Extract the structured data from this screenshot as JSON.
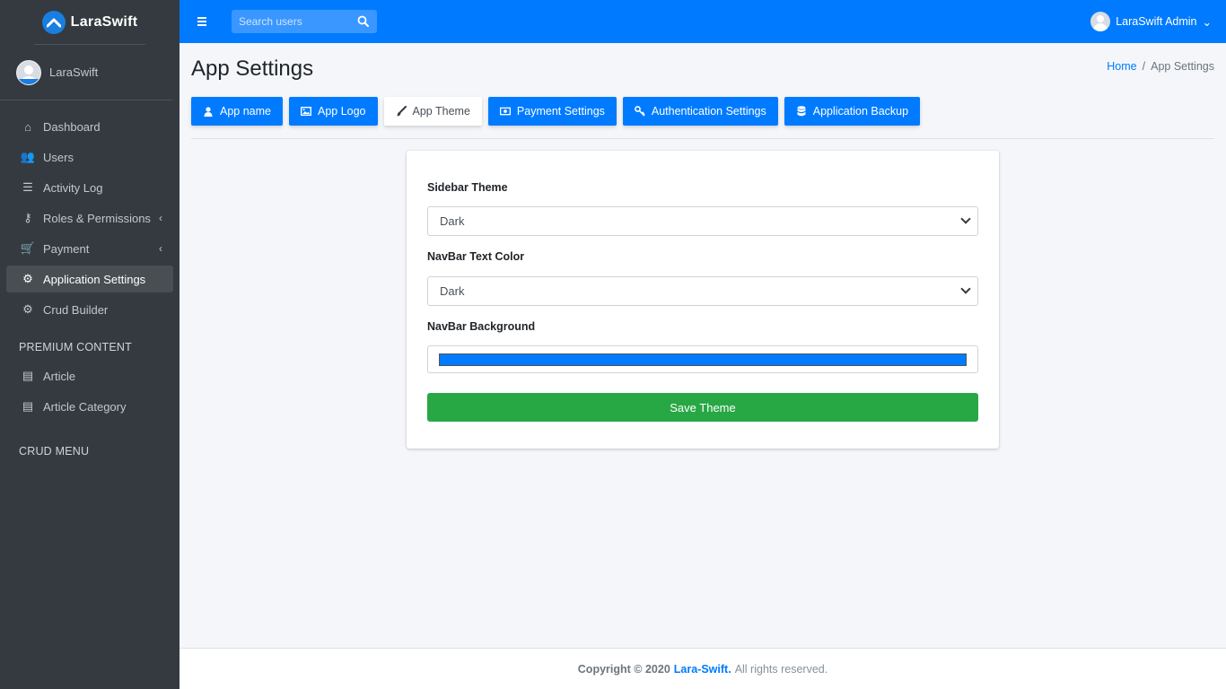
{
  "brand": {
    "name": "LaraSwift",
    "logo_icon": "swift-logo-icon",
    "accent": "#1a7de0"
  },
  "sidebar": {
    "user_name": "LaraSwift",
    "items": [
      {
        "label": "Dashboard",
        "icon": "home-icon",
        "glyph": "⌂"
      },
      {
        "label": "Users",
        "icon": "users-icon",
        "glyph": "👥"
      },
      {
        "label": "Activity Log",
        "icon": "list-icon",
        "glyph": "☰"
      },
      {
        "label": "Roles & Permissions",
        "icon": "key-icon",
        "glyph": "⚷",
        "arrow": "‹"
      },
      {
        "label": "Payment",
        "icon": "cart-icon",
        "glyph": "🛒",
        "arrow": "‹"
      },
      {
        "label": "Application Settings",
        "icon": "gear-icon",
        "glyph": "⚙",
        "active": true
      },
      {
        "label": "Crud Builder",
        "icon": "gear-icon",
        "glyph": "⚙"
      }
    ],
    "premium_header": "PREMIUM CONTENT",
    "premium_items": [
      {
        "label": "Article",
        "icon": "newspaper-icon",
        "glyph": "▤"
      },
      {
        "label": "Article Category",
        "icon": "newspaper-icon",
        "glyph": "▤"
      }
    ],
    "crud_header": "CRUD MENU"
  },
  "navbar": {
    "background": "#007bff",
    "search_placeholder": "Search users",
    "user_label": "LaraSwift Admin",
    "caret": "⌄"
  },
  "page": {
    "title": "App Settings",
    "breadcrumb": {
      "home": "Home",
      "separator": "/",
      "current": "App Settings"
    }
  },
  "tabs": [
    {
      "label": "App name",
      "icon": "user-icon",
      "glyph": "👤"
    },
    {
      "label": "App Logo",
      "icon": "image-icon",
      "glyph": "▧"
    },
    {
      "label": "App Theme",
      "icon": "paintbrush-icon",
      "glyph": "🖌",
      "active": true
    },
    {
      "label": "Payment Settings",
      "icon": "money-icon",
      "glyph": "▣"
    },
    {
      "label": "Authentication Settings",
      "icon": "key-icon",
      "glyph": "⚷"
    },
    {
      "label": "Application Backup",
      "icon": "database-icon",
      "glyph": "⛁"
    }
  ],
  "form": {
    "sidebar_theme_label": "Sidebar Theme",
    "sidebar_theme_value": "Dark",
    "navbar_text_label": "NavBar Text Color",
    "navbar_text_value": "Dark",
    "navbar_bg_label": "NavBar Background",
    "navbar_bg_value": "#007bff",
    "save_label": "Save Theme",
    "save_color": "#28a745"
  },
  "footer": {
    "copyright": "Copyright © 2020",
    "brand": "Lara-Swift.",
    "rights": "All rights reserved."
  }
}
